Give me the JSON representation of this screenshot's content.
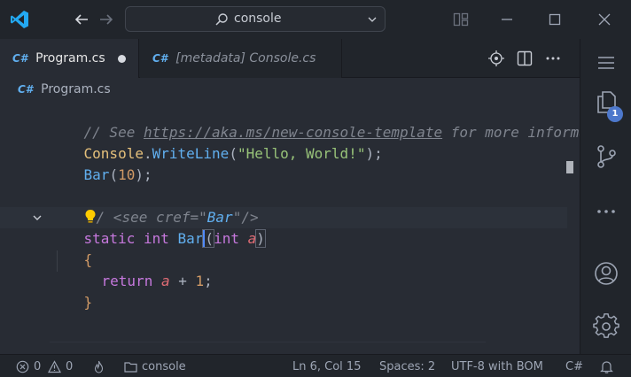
{
  "titlebar": {
    "search_text": "console"
  },
  "tabs": [
    {
      "icon": "C#",
      "label": "Program.cs",
      "dirty": true
    },
    {
      "icon": "C#",
      "label": "[metadata] Console.cs",
      "dirty": false
    }
  ],
  "breadcrumb": {
    "icon": "C#",
    "label": "Program.cs"
  },
  "editor": {
    "line1": {
      "comment_prefix": "// See ",
      "link": "https://aka.ms/new-console-template",
      "comment_suffix": " for more information"
    },
    "line2": {
      "class": "Console",
      "dot": ".",
      "method": "WriteLine",
      "open": "(",
      "string": "\"Hello, World!\"",
      "close": ");"
    },
    "line3": {
      "method": "Bar",
      "open": "(",
      "number": "10",
      "close": ");"
    },
    "line5": {
      "slashes": "/",
      "tag_open": " <see ",
      "attr": "cref=",
      "attrval_open": "\"",
      "attrval": "Bar",
      "attrval_close": "\"",
      "tag_close": "/>"
    },
    "line6": {
      "kw_static": "static",
      "kw_int": "int",
      "method": "Bar",
      "paren_open": "(",
      "kw_int2": "int",
      "param": "a",
      "paren_close": ")"
    },
    "line7": {
      "brace": "{"
    },
    "line8": {
      "kw_return": "return",
      "param": "a",
      "op": " + ",
      "number": "1",
      "semi": ";"
    },
    "line9": {
      "brace": "}"
    }
  },
  "activitybar": {
    "explorer_badge": "1"
  },
  "statusbar": {
    "errors": "0",
    "warnings": "0",
    "folder": "console",
    "position": "Ln 6, Col 15",
    "spaces": "Spaces: 2",
    "encoding": "UTF-8 with BOM",
    "language": "C#"
  },
  "colors": {
    "accent": "#61afef",
    "logo": "#23a9f2",
    "badge": "#4d78cc"
  }
}
